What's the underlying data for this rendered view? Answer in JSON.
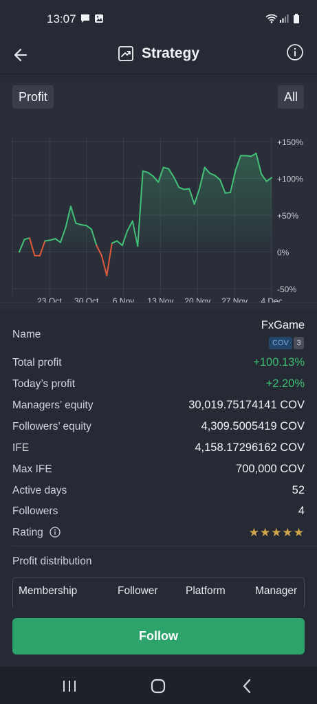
{
  "status": {
    "time": "13:07"
  },
  "header": {
    "title": "Strategy"
  },
  "chart": {
    "left_label": "Profit",
    "right_label": "All"
  },
  "chart_data": {
    "type": "line",
    "x_ticks": [
      "23 Oct",
      "30 Oct",
      "6 Nov",
      "13 Nov",
      "20 Nov",
      "27 Nov",
      "4 Dec"
    ],
    "y_ticks": [
      "+150%",
      "+100%",
      "+50%",
      "0%",
      "-50%"
    ],
    "ylim": [
      -50,
      150
    ],
    "grid": true,
    "values": [
      0,
      17,
      19,
      -5,
      -5,
      15,
      16,
      18,
      13,
      33,
      62,
      39,
      37,
      36,
      31,
      9,
      -5,
      -32,
      12,
      15,
      9,
      29,
      42,
      8,
      110,
      108,
      103,
      95,
      115,
      113,
      102,
      88,
      85,
      86,
      65,
      86,
      115,
      107,
      104,
      98,
      80,
      81,
      111,
      131,
      131,
      130,
      134,
      106,
      96,
      101
    ],
    "positive_color": "#43c178",
    "negative_color": "#e05a3a"
  },
  "details": {
    "name_label": "Name",
    "name_value": "FxGame",
    "coin_badge": "COV",
    "count_badge": "3",
    "total_profit_label": "Total profit",
    "total_profit_value": "+100.13%",
    "today_profit_label": "Today’s profit",
    "today_profit_value": "+2.20%",
    "managers_equity_label": "Managers’ equity",
    "managers_equity_value": "30,019.75174141 COV",
    "followers_equity_label": "Followers’ equity",
    "followers_equity_value": "4,309.5005419 COV",
    "ife_label": "IFE",
    "ife_value": "4,158.17296162 COV",
    "max_ife_label": "Max IFE",
    "max_ife_value": "700,000 COV",
    "active_days_label": "Active days",
    "active_days_value": "52",
    "followers_label": "Followers",
    "followers_value": "4",
    "rating_label": "Rating",
    "rating_stars": "★★★★★",
    "rating_value": 5
  },
  "distribution": {
    "title": "Profit distribution",
    "columns": [
      "Membership",
      "Follower",
      "Platform",
      "Manager"
    ]
  },
  "follow_button": "Follow"
}
